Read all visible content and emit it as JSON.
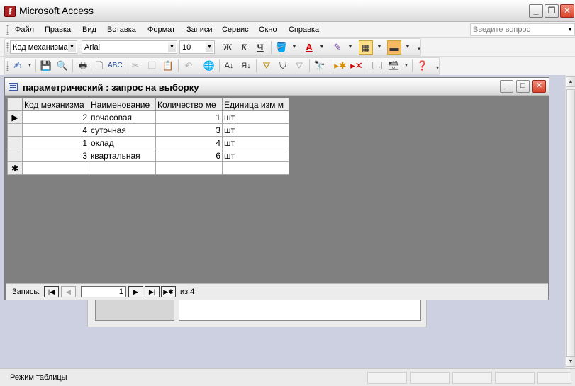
{
  "app": {
    "title": "Microsoft Access",
    "icon": "access-key-icon"
  },
  "menu": {
    "items": [
      "Файл",
      "Правка",
      "Вид",
      "Вставка",
      "Формат",
      "Записи",
      "Сервис",
      "Окно",
      "Справка"
    ],
    "help_placeholder": "Введите вопрос"
  },
  "formatting": {
    "field_combo": "Код механизма",
    "font_combo": "Arial",
    "size_combo": "10",
    "bold_label": "Ж",
    "italic_label": "К",
    "underline_label": "Ч"
  },
  "query_window": {
    "title": "параметрический : запрос на выборку",
    "columns": [
      "Код механизма",
      "Наименование",
      "Количество ме",
      "Единица изм м"
    ],
    "rows": [
      {
        "code": "2",
        "name": "почасовая",
        "qty": "1",
        "unit": "шт"
      },
      {
        "code": "4",
        "name": "суточная",
        "qty": "3",
        "unit": "шт"
      },
      {
        "code": "1",
        "name": "оклад",
        "qty": "4",
        "unit": "шт"
      },
      {
        "code": "3",
        "name": "квартальная",
        "qty": "6",
        "unit": "шт"
      }
    ],
    "new_row_marker": "✱",
    "current_row_marker": "▶"
  },
  "navigator": {
    "label": "Запись:",
    "current": "1",
    "of_text": "из  4"
  },
  "status": {
    "text": "Режим таблицы"
  },
  "colors": {
    "workspace": "#cdd0e0",
    "datasheet_bg": "#808080",
    "close_button": "#d8432b"
  }
}
